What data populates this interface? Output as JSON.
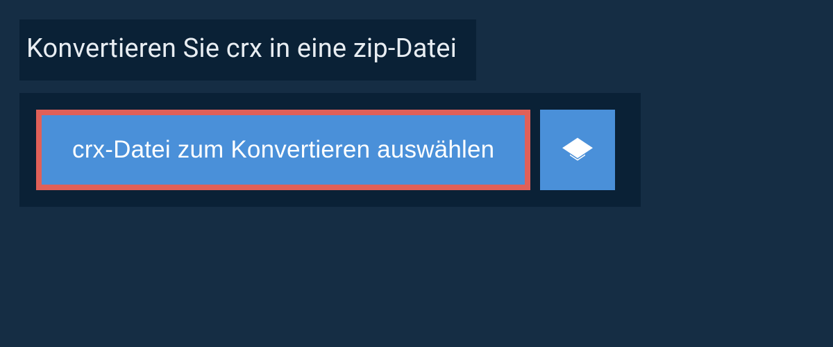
{
  "heading": "Konvertieren Sie crx in eine zip-Datei",
  "upload": {
    "select_label": "crx-Datei zum Konvertieren auswählen"
  }
}
